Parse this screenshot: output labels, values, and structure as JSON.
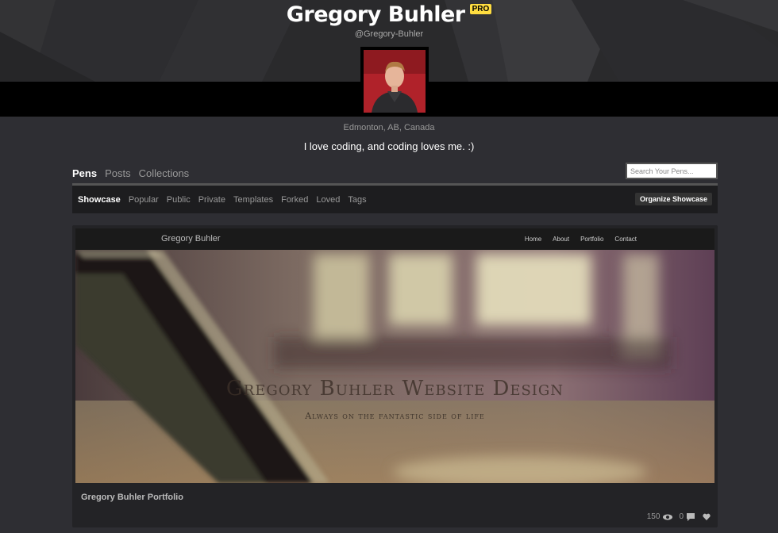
{
  "profile": {
    "name": "Gregory Buhler",
    "badge": "PRO",
    "handle": "@Gregory-Buhler",
    "location": "Edmonton, AB, Canada",
    "bio": "I love coding, and coding loves me. :)"
  },
  "main_tabs": [
    {
      "label": "Pens",
      "active": true
    },
    {
      "label": "Posts",
      "active": false
    },
    {
      "label": "Collections",
      "active": false
    }
  ],
  "search": {
    "placeholder": "Search Your Pens..."
  },
  "sub_nav": {
    "items": [
      {
        "label": "Showcase",
        "active": true
      },
      {
        "label": "Popular",
        "active": false
      },
      {
        "label": "Public",
        "active": false
      },
      {
        "label": "Private",
        "active": false
      },
      {
        "label": "Templates",
        "active": false
      },
      {
        "label": "Forked",
        "active": false
      },
      {
        "label": "Loved",
        "active": false
      },
      {
        "label": "Tags",
        "active": false
      }
    ],
    "organize_label": "Organize Showcase"
  },
  "pen": {
    "title": "Gregory Buhler Portfolio",
    "preview": {
      "brand": "Gregory Buhler",
      "links": [
        "Home",
        "About",
        "Portfolio",
        "Contact"
      ],
      "hero_title": "Gregory Buhler Website Design",
      "hero_subtitle": "Always on the fantastic side of life"
    },
    "stats": {
      "views": "150",
      "comments": "0"
    }
  },
  "colors": {
    "background": "#2e2e33",
    "banner": "#2a2a2c",
    "pro_badge": "#ffdd40",
    "avatar_bg": "#b0222a"
  },
  "icons": {
    "views": "eye-icon",
    "comments": "comment-icon",
    "love": "heart-icon"
  }
}
